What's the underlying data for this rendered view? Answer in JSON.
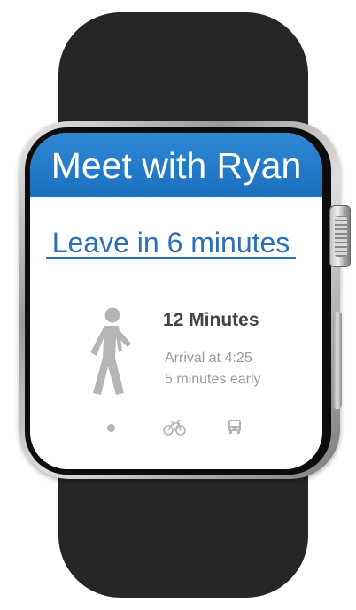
{
  "event": {
    "title": "Meet with Ryan",
    "leave_text": "Leave in 6 minutes"
  },
  "travel": {
    "mode_icon": "walking-person-icon",
    "duration": "12 Minutes",
    "arrival": "Arrival at 4:25",
    "early": "5 minutes early"
  },
  "mode_selector": {
    "options": [
      "walk-dot-icon",
      "bicycle-icon",
      "bus-icon"
    ]
  },
  "colors": {
    "header_blue": "#1c71bf",
    "link_blue": "#2b6fb6",
    "icon_gray": "#b5b5b5",
    "strap": "#262626"
  }
}
